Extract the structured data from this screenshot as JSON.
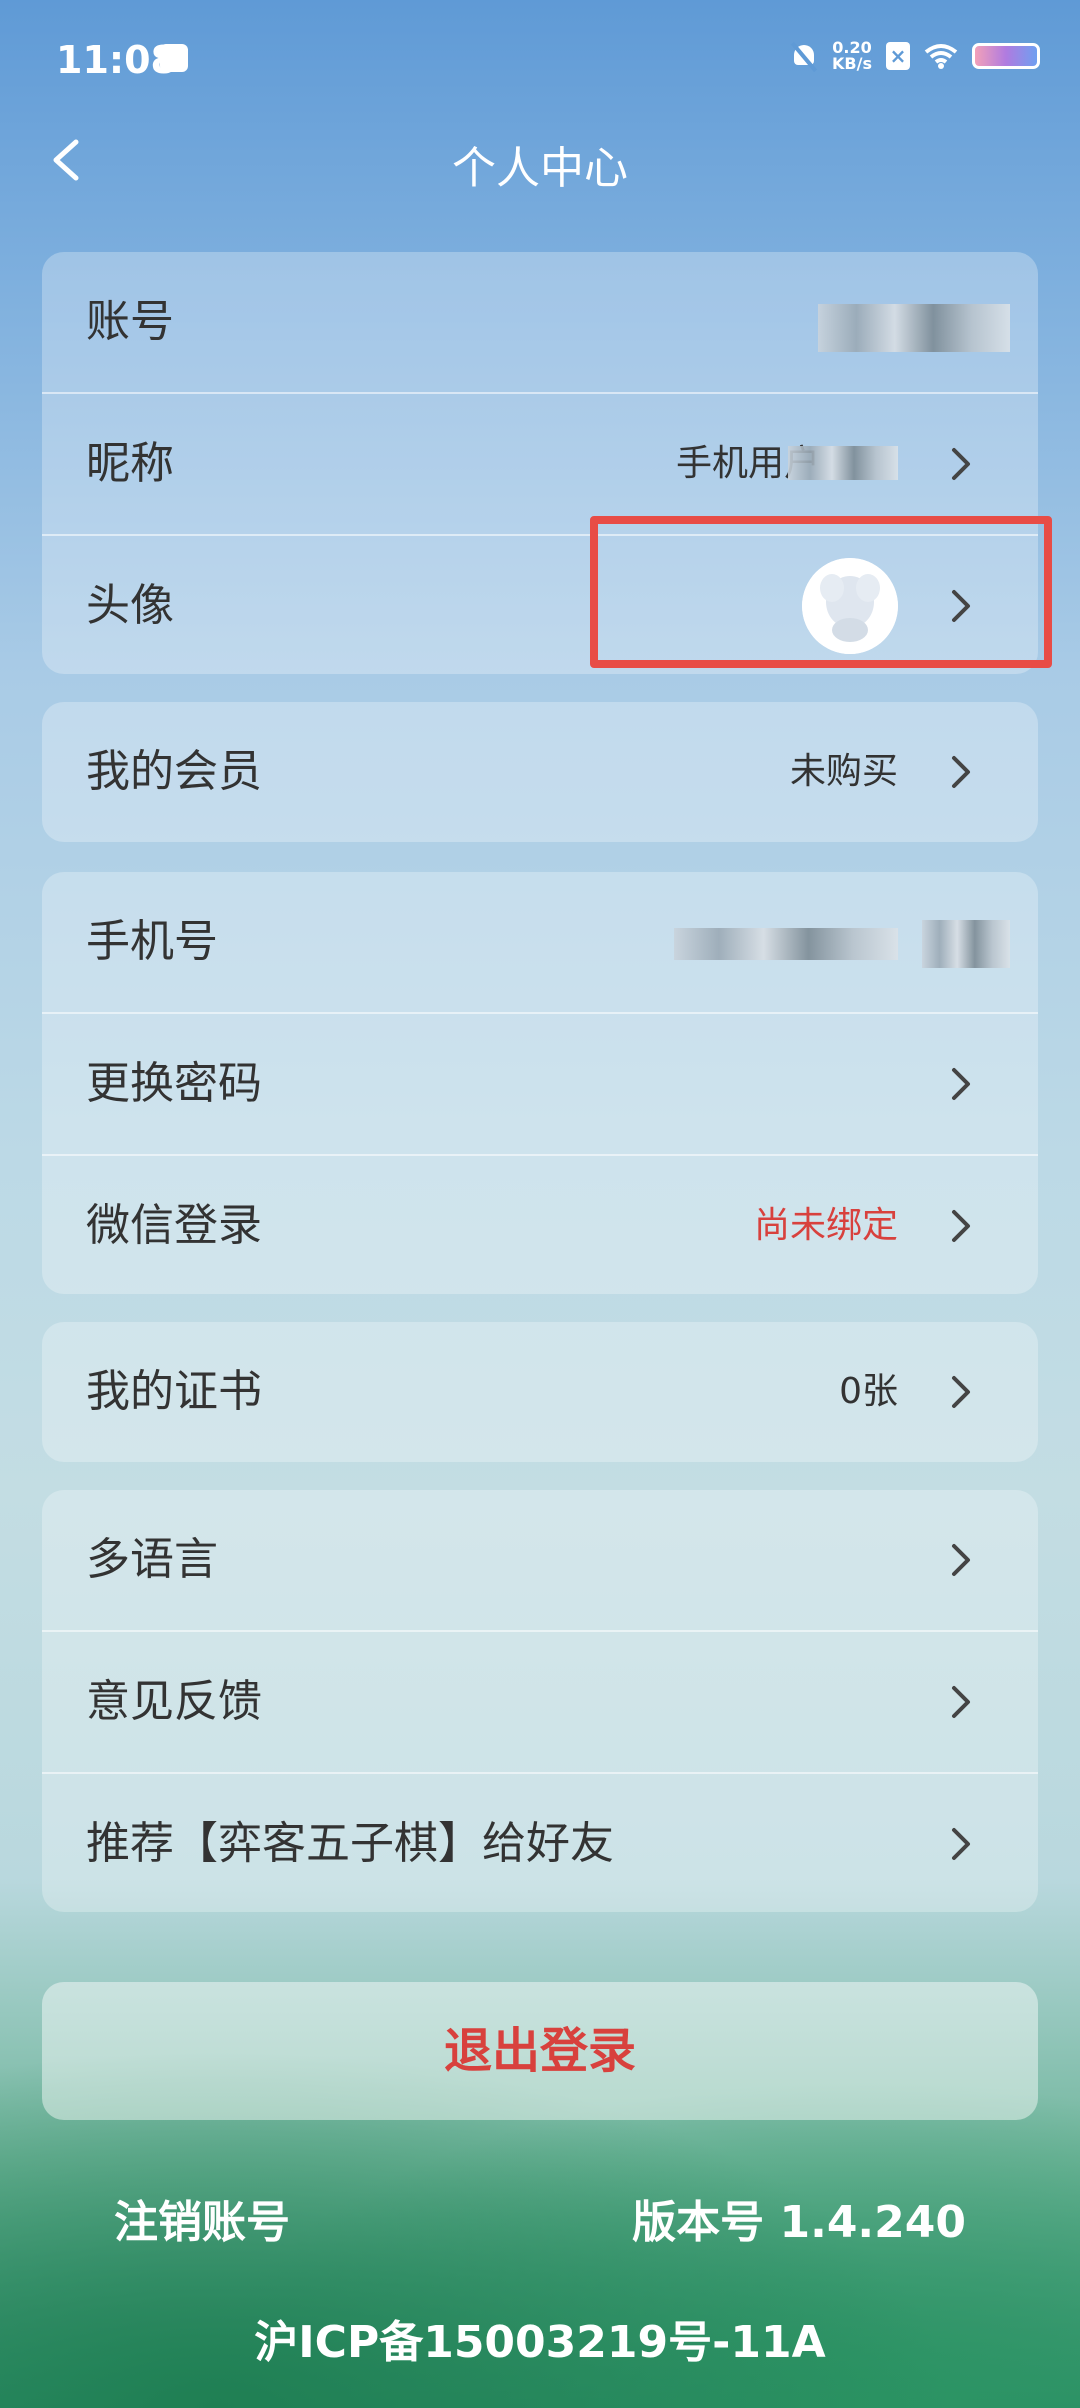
{
  "status_bar": {
    "time": "11:08",
    "net_speed_value": "0.20",
    "net_speed_unit": "KB/s"
  },
  "header": {
    "title": "个人中心"
  },
  "groups": {
    "account": {
      "account_label": "账号",
      "nickname_label": "昵称",
      "nickname_value": "手机用户",
      "avatar_label": "头像"
    },
    "membership": {
      "label": "我的会员",
      "value": "未购买"
    },
    "security": {
      "phone_label": "手机号",
      "password_label": "更换密码",
      "wechat_label": "微信登录",
      "wechat_value": "尚未绑定"
    },
    "certificate": {
      "label": "我的证书",
      "value": "0张"
    },
    "misc": {
      "language_label": "多语言",
      "feedback_label": "意见反馈",
      "recommend_label": "推荐【弈客五子棋】给好友"
    }
  },
  "logout_label": "退出登录",
  "footer": {
    "cancel_account": "注销账号",
    "version": "版本号 1.4.240",
    "icp": "沪ICP备15003219号-11A"
  },
  "colors": {
    "accent_red": "#d8413d",
    "highlight_border": "#e84c46"
  }
}
